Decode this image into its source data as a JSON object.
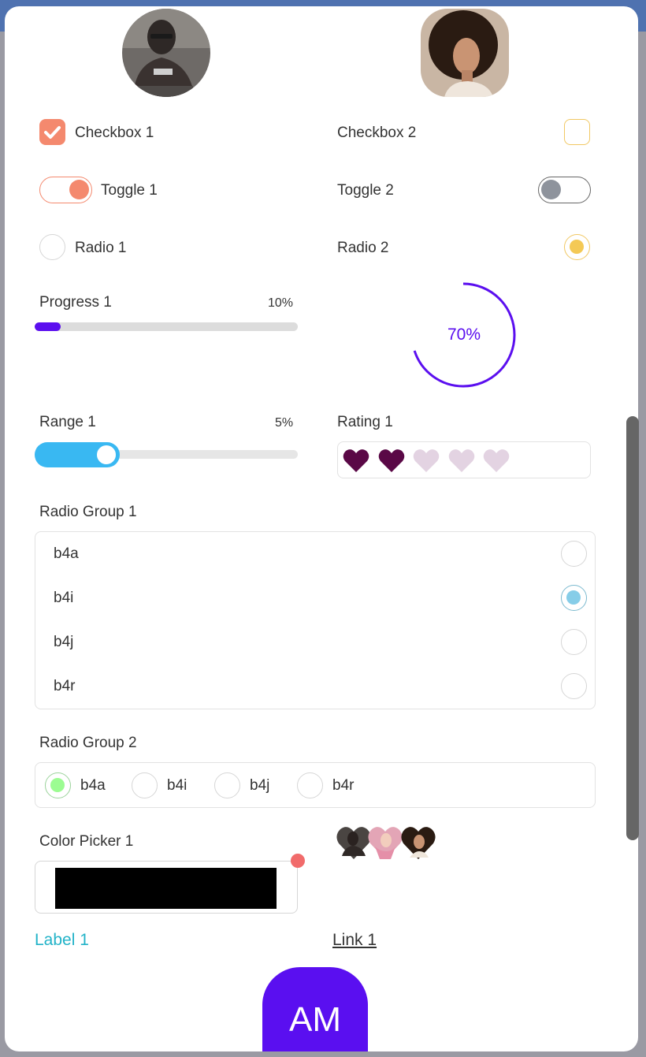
{
  "checkbox1": {
    "label": "Checkbox 1",
    "checked": true,
    "color": "#f4896e"
  },
  "checkbox2": {
    "label": "Checkbox 2",
    "checked": false,
    "color": "#f1c863"
  },
  "toggle1": {
    "label": "Toggle 1",
    "on": true,
    "color": "#f4896e"
  },
  "toggle2": {
    "label": "Toggle 2",
    "on": false,
    "color": "#8e939c"
  },
  "radio1": {
    "label": "Radio 1",
    "selected": false
  },
  "radio2": {
    "label": "Radio 2",
    "selected": true,
    "color": "#f4c955"
  },
  "progress1": {
    "label": "Progress 1",
    "value_text": "10%",
    "value": 0.1,
    "color": "#5b0fef"
  },
  "circular_progress": {
    "value_text": "70%",
    "value": 0.7,
    "color": "#5b0fef"
  },
  "range1": {
    "label": "Range 1",
    "value_text": "5%",
    "color": "#39b8f2"
  },
  "rating1": {
    "label": "Rating 1",
    "value": 2,
    "max": 5,
    "filled_color": "#5a0846",
    "empty_color": "#e3d3e2"
  },
  "radio_group1": {
    "label": "Radio Group 1",
    "options": [
      "b4a",
      "b4i",
      "b4j",
      "b4r"
    ],
    "selected": "b4i",
    "color": "#86cde8"
  },
  "radio_group2": {
    "label": "Radio Group 2",
    "options": [
      "b4a",
      "b4i",
      "b4j",
      "b4r"
    ],
    "selected": "b4a",
    "color": "#9cfc92"
  },
  "color_picker1": {
    "label": "Color Picker 1",
    "value": "#000000"
  },
  "label1": {
    "text": "Label 1"
  },
  "link1": {
    "text": "Link 1"
  },
  "avatar_initials": {
    "text": "AM",
    "color": "#5a0ff0"
  }
}
